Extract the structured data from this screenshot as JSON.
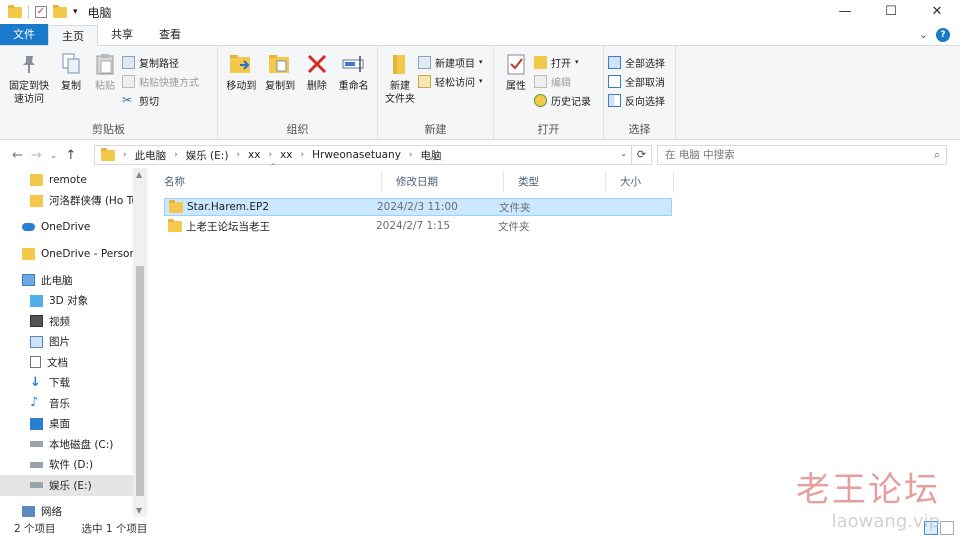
{
  "window": {
    "title": "电脑"
  },
  "title_controls": {
    "minimize": "—",
    "maximize": "☐",
    "close": "✕"
  },
  "qat": {
    "dropdown": "▾"
  },
  "tabs": [
    {
      "label": "文件"
    },
    {
      "label": "主页"
    },
    {
      "label": "共享"
    },
    {
      "label": "查看"
    }
  ],
  "tabs_right": {
    "expand": "⌄"
  },
  "ribbon": {
    "clipboard": {
      "label": "剪贴板",
      "pin": "固定到快\n速访问",
      "copy": "复制",
      "paste": "粘贴",
      "copy_path": "复制路径",
      "paste_shortcut": "粘贴快捷方式",
      "cut": "剪切"
    },
    "organize": {
      "label": "组织",
      "move_to": "移动到",
      "copy_to": "复制到",
      "delete": "删除",
      "rename": "重命名"
    },
    "new": {
      "label": "新建",
      "new_folder": "新建\n文件夹",
      "new_item": "新建项目",
      "easy_access": "轻松访问"
    },
    "open": {
      "label": "打开",
      "properties": "属性",
      "open": "打开",
      "edit": "编辑",
      "history": "历史记录"
    },
    "select": {
      "label": "选择",
      "select_all": "全部选择",
      "select_none": "全部取消",
      "invert": "反向选择"
    }
  },
  "nav_buttons": {
    "back": "←",
    "forward": "→",
    "recent": "⌄",
    "up": "↑"
  },
  "address": {
    "crumbs": [
      "此电脑",
      "娱乐 (E:)",
      "xx",
      "xx",
      "Hrweonasetuany",
      "电脑"
    ],
    "separator": "›",
    "dropdown": "⌄",
    "refresh": "⟳"
  },
  "search": {
    "placeholder": "在 电脑 中搜索",
    "icon": "⌕"
  },
  "navpane": {
    "items": [
      {
        "label": "remote",
        "icon": "folder-icon"
      },
      {
        "label": "河洛群侠傳 (Ho Tu",
        "icon": "folder-icon"
      },
      {
        "label": "OneDrive",
        "icon": "cloud-icon"
      },
      {
        "label": "OneDrive - Person",
        "icon": "folder-icon"
      },
      {
        "label": "此电脑",
        "icon": "computer-icon"
      },
      {
        "label": "3D 对象",
        "icon": "cube-icon"
      },
      {
        "label": "视频",
        "icon": "video-icon"
      },
      {
        "label": "图片",
        "icon": "picture-icon"
      },
      {
        "label": "文档",
        "icon": "document-icon"
      },
      {
        "label": "下载",
        "icon": "download-icon"
      },
      {
        "label": "音乐",
        "icon": "music-icon"
      },
      {
        "label": "桌面",
        "icon": "desktop-icon"
      },
      {
        "label": "本地磁盘 (C:)",
        "icon": "drive-icon"
      },
      {
        "label": "软件 (D:)",
        "icon": "drive-icon"
      },
      {
        "label": "娱乐 (E:)",
        "icon": "drive-icon"
      },
      {
        "label": "网络",
        "icon": "network-icon"
      }
    ],
    "scroll_up": "▲",
    "scroll_down": "▼"
  },
  "columns": {
    "name": "名称",
    "modified": "修改日期",
    "type": "类型",
    "size": "大小",
    "sort_arrow": "^"
  },
  "files": [
    {
      "name": "Star.Harem.EP2",
      "modified": "2024/2/3 11:00",
      "type": "文件夹"
    },
    {
      "name": "上老王论坛当老王",
      "modified": "2024/2/7 1:15",
      "type": "文件夹"
    }
  ],
  "status": {
    "count": "2 个项目",
    "selected": "选中 1 个项目"
  },
  "watermark": {
    "line1": "老王论坛",
    "line2": "laowang.vip"
  },
  "colors": {
    "accent": "#1979ca",
    "selection": "#cce8ff",
    "folder": "#f3c84b"
  }
}
